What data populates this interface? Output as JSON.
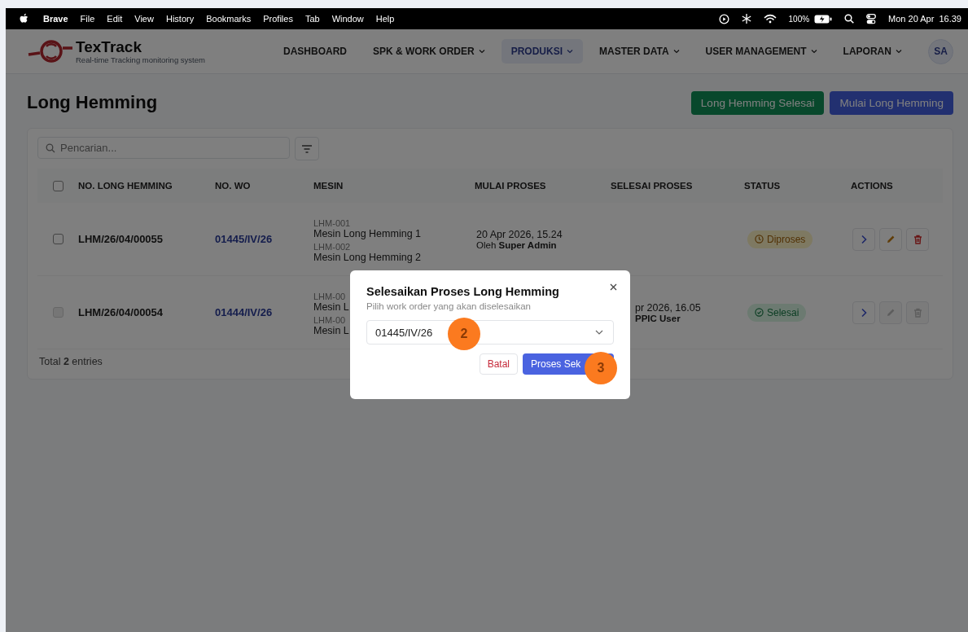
{
  "menubar": {
    "app": "Brave",
    "items": [
      "File",
      "Edit",
      "View",
      "History",
      "Bookmarks",
      "Profiles",
      "Tab",
      "Window",
      "Help"
    ],
    "battery": "100%",
    "clock": "Mon 20 Apr  16.39"
  },
  "header": {
    "brand": "TexTrack",
    "tagline": "Real-time Tracking monitoring system",
    "avatar": "SA",
    "nav": [
      {
        "label": "DASHBOARD",
        "dropdown": false,
        "selected": false
      },
      {
        "label": "SPK & WORK ORDER",
        "dropdown": true,
        "selected": false
      },
      {
        "label": "PRODUKSI",
        "dropdown": true,
        "selected": true
      },
      {
        "label": "MASTER DATA",
        "dropdown": true,
        "selected": false
      },
      {
        "label": "USER MANAGEMENT",
        "dropdown": true,
        "selected": false
      },
      {
        "label": "LAPORAN",
        "dropdown": true,
        "selected": false
      }
    ]
  },
  "page": {
    "title": "Long Hemming",
    "buttons": [
      {
        "label": "Long Hemming Selesai",
        "kind": "success"
      },
      {
        "label": "Mulai Long Hemming",
        "kind": "primary"
      }
    ]
  },
  "search": {
    "placeholder": "Pencarian..."
  },
  "table": {
    "columns": [
      "NO. LONG HEMMING",
      "NO. WO",
      "MESIN",
      "MULAI PROSES",
      "SELESAI PROSES",
      "STATUS",
      "ACTIONS"
    ],
    "all_checked": false,
    "rows": [
      {
        "checked": false,
        "disabled": false,
        "no": "LHM/26/04/00055",
        "wo": "01445/IV/26",
        "machines": [
          {
            "code": "LHM-001",
            "name": "Mesin Long Hemming 1"
          },
          {
            "code": "LHM-002",
            "name": "Mesin Long Hemming 2"
          }
        ],
        "start": {
          "date": "20 Apr 2026, 15.24",
          "prefix": "Oleh",
          "by": "Super Admin"
        },
        "status": {
          "label": "Diproses",
          "kind": "process"
        },
        "edit_disabled": false,
        "delete_disabled": false
      },
      {
        "checked": false,
        "disabled": true,
        "no": "LHM/26/04/00054",
        "wo": "01444/IV/26",
        "machines": [
          {
            "code": "LHM-00",
            "name": "Mesin L"
          },
          {
            "code": "LHM-00",
            "name": "Mesin L"
          }
        ],
        "end": {
          "date": "pr 2026, 16.05",
          "by": "PPIC User"
        },
        "status": {
          "label": "Selesai",
          "kind": "done"
        },
        "edit_disabled": true,
        "delete_disabled": true
      }
    ]
  },
  "footer": {
    "prefix": "Total",
    "count": "2",
    "suffix": "entries"
  },
  "modal": {
    "title": "Selesaikan Proses Long Hemming",
    "subtitle": "Pilih work order yang akan diselesaikan",
    "value": "01445/IV/26",
    "cancel": "Batal",
    "confirm": "Proses Sek",
    "markers": [
      "2",
      "3"
    ]
  }
}
